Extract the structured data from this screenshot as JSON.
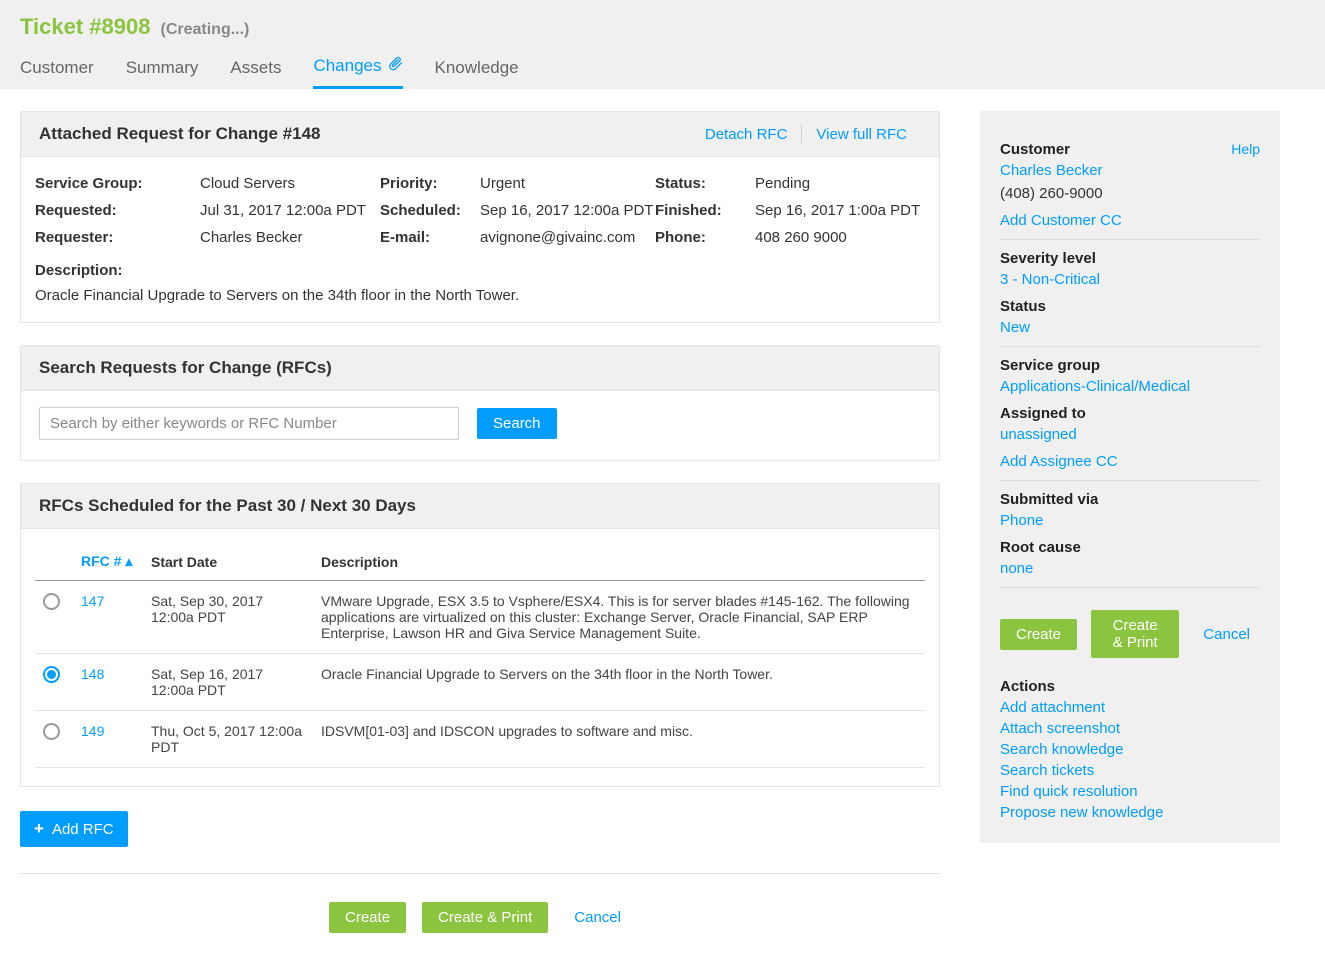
{
  "header": {
    "title": "Ticket #8908",
    "subtitle": "(Creating...)"
  },
  "tabs": [
    "Customer",
    "Summary",
    "Assets",
    "Changes",
    "Knowledge"
  ],
  "active_tab": "Changes",
  "attached_rfc": {
    "title": "Attached Request for Change #148",
    "detach": "Detach RFC",
    "view_full": "View full RFC",
    "fields": {
      "service_group_label": "Service Group:",
      "service_group": "Cloud Servers",
      "priority_label": "Priority:",
      "priority": "Urgent",
      "status_label": "Status:",
      "status": "Pending",
      "requested_label": "Requested:",
      "requested": "Jul 31, 2017 12:00a PDT",
      "scheduled_label": "Scheduled:",
      "scheduled": "Sep 16, 2017 12:00a PDT",
      "finished_label": "Finished:",
      "finished": "Sep 16, 2017 1:00a PDT",
      "requester_label": "Requester:",
      "requester": "Charles Becker",
      "email_label": "E-mail:",
      "email": "avignone@givainc.com",
      "phone_label": "Phone:",
      "phone": "408 260 9000",
      "description_label": "Description:",
      "description": "Oracle Financial Upgrade to Servers on the 34th floor in the North Tower."
    }
  },
  "search_panel": {
    "title": "Search Requests for Change (RFCs)",
    "placeholder": "Search by either keywords or RFC Number",
    "button": "Search"
  },
  "rfc_schedule": {
    "title": "RFCs Scheduled for the Past 30 / Next 30 Days",
    "cols": {
      "rfc": "RFC # ▴",
      "start": "Start Date",
      "desc": "Description"
    },
    "rows": [
      {
        "selected": false,
        "rfc": "147",
        "start": "Sat, Sep 30, 2017 12:00a PDT",
        "desc": "VMware Upgrade, ESX 3.5 to Vsphere/ESX4. This is for server blades #145-162. The following applications are virtualized on this cluster: Exchange Server, Oracle Financial, SAP ERP Enterprise, Lawson HR and Giva Service Management Suite."
      },
      {
        "selected": true,
        "rfc": "148",
        "start": "Sat, Sep 16, 2017 12:00a PDT",
        "desc": "Oracle Financial Upgrade to Servers on the 34th floor in the North Tower."
      },
      {
        "selected": false,
        "rfc": "149",
        "start": "Thu, Oct 5, 2017 12:00a PDT",
        "desc": "IDSVM[01-03] and IDSCON upgrades to software and misc."
      }
    ]
  },
  "add_rfc": "Add RFC",
  "footer_buttons": {
    "create": "Create",
    "create_print": "Create & Print",
    "cancel": "Cancel"
  },
  "sidebar": {
    "help": "Help",
    "customer_label": "Customer",
    "customer_name": "Charles Becker",
    "customer_phone": "(408) 260-9000",
    "add_customer_cc": "Add Customer CC",
    "severity_label": "Severity level",
    "severity": "3 - Non-Critical",
    "status_label": "Status",
    "status": "New",
    "service_group_label": "Service group",
    "service_group": "Applications-Clinical/Medical",
    "assigned_label": "Assigned to",
    "assigned": "unassigned",
    "add_assignee_cc": "Add Assignee CC",
    "submitted_label": "Submitted via",
    "submitted": "Phone",
    "root_cause_label": "Root cause",
    "root_cause": "none",
    "buttons": {
      "create": "Create",
      "create_print": "Create & Print",
      "cancel": "Cancel"
    },
    "actions_label": "Actions",
    "actions": [
      "Add attachment",
      "Attach screenshot",
      "Search knowledge",
      "Search tickets",
      "Find quick resolution",
      "Propose new knowledge"
    ]
  }
}
